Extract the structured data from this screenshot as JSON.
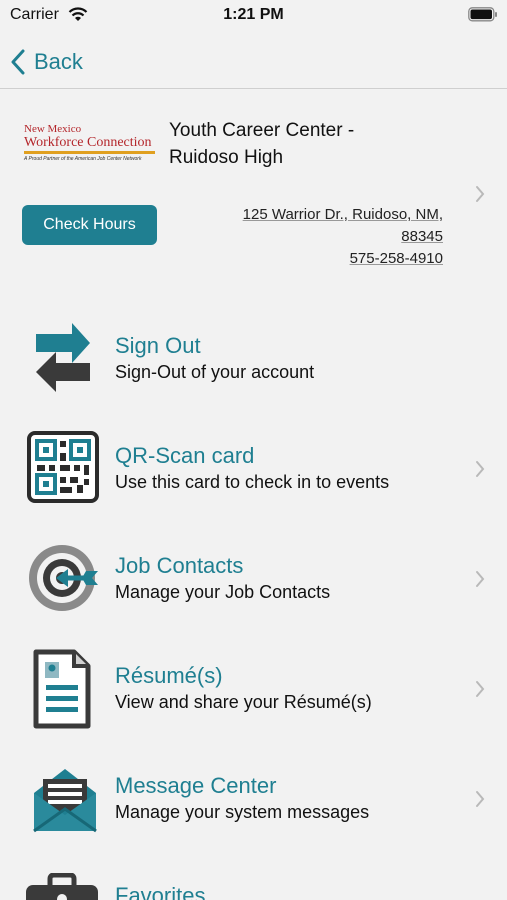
{
  "status": {
    "carrier": "Carrier",
    "time": "1:21 PM"
  },
  "nav": {
    "back_label": "Back"
  },
  "center": {
    "logo": {
      "line1": "New Mexico",
      "line2": "Workforce Connection",
      "tagline": "A Proud Partner of the American Job Center Network"
    },
    "name": "Youth Career Center - Ruidoso High",
    "check_hours_label": "Check Hours",
    "address_line1": "125 Warrior Dr., Ruidoso, NM,",
    "address_line2": "88345",
    "phone": "575-258-4910"
  },
  "menu": [
    {
      "title": "Sign Out",
      "subtitle": "Sign-Out of your account",
      "icon": "sign-out-arrows-icon"
    },
    {
      "title": "QR-Scan card",
      "subtitle": "Use this card to check in to events",
      "icon": "qr-code-icon"
    },
    {
      "title": "Job Contacts",
      "subtitle": "Manage your Job Contacts",
      "icon": "target-icon"
    },
    {
      "title": "Résumé(s)",
      "subtitle": "View and share your Résumé(s)",
      "icon": "resume-document-icon"
    },
    {
      "title": "Message Center",
      "subtitle": "Manage your system messages",
      "icon": "envelope-icon"
    },
    {
      "title": "Favorites",
      "subtitle": "",
      "icon": "briefcase-icon"
    }
  ],
  "colors": {
    "accent": "#1f7f91",
    "icon_dark": "#3a3a3a",
    "background": "#f2f2f2"
  }
}
